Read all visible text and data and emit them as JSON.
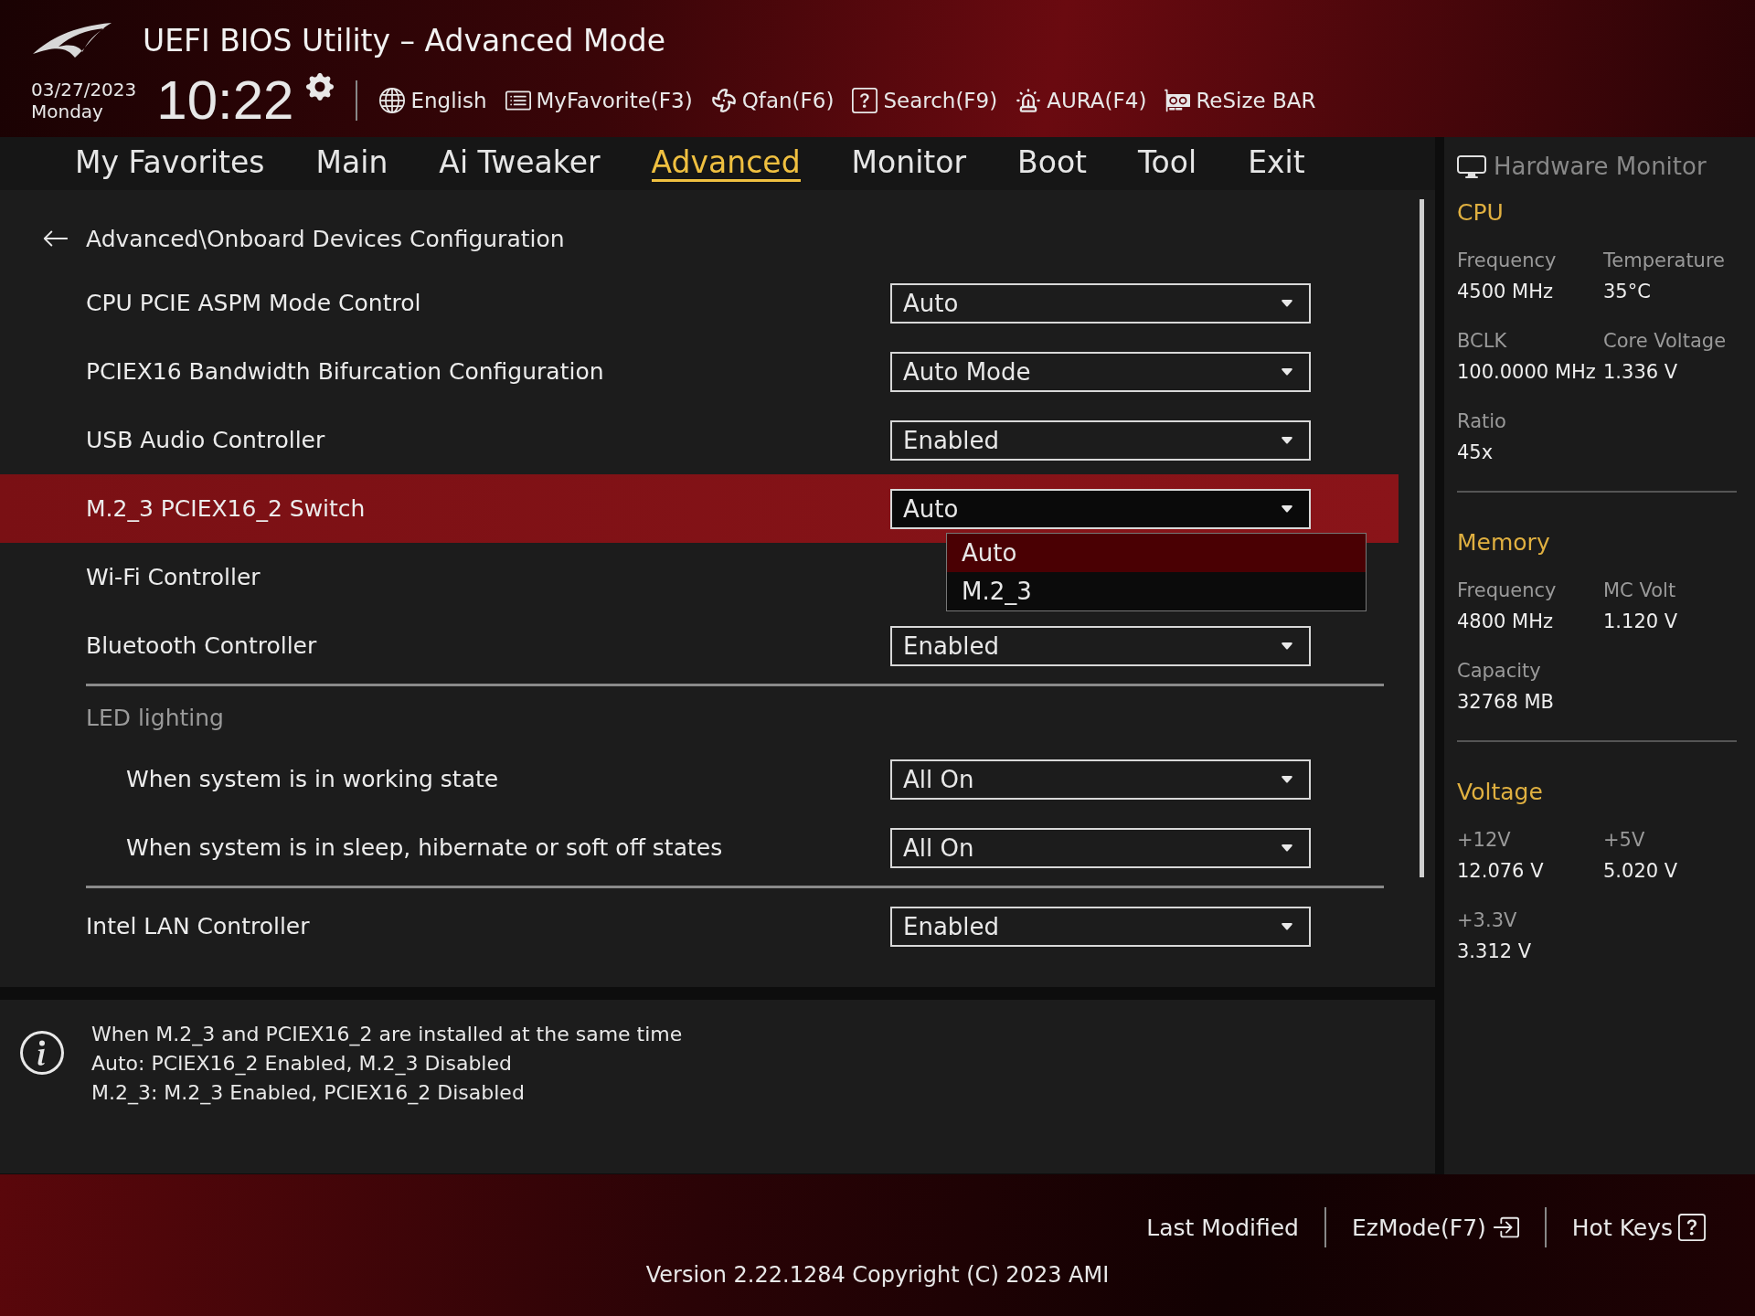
{
  "header": {
    "title": "UEFI BIOS Utility – Advanced Mode",
    "date": "03/27/2023",
    "weekday": "Monday",
    "time": "10:22",
    "tools": [
      {
        "kind": "language",
        "label": "English"
      },
      {
        "kind": "favorite",
        "label": "MyFavorite(F3)"
      },
      {
        "kind": "fan",
        "label": "Qfan(F6)"
      },
      {
        "kind": "search",
        "label": "Search(F9)"
      },
      {
        "kind": "aura",
        "label": "AURA(F4)"
      },
      {
        "kind": "resize",
        "label": "ReSize BAR"
      }
    ]
  },
  "tabs": [
    {
      "label": "My Favorites",
      "selected": false
    },
    {
      "label": "Main",
      "selected": false
    },
    {
      "label": "Ai Tweaker",
      "selected": false
    },
    {
      "label": "Advanced",
      "selected": true
    },
    {
      "label": "Monitor",
      "selected": false
    },
    {
      "label": "Boot",
      "selected": false
    },
    {
      "label": "Tool",
      "selected": false
    },
    {
      "label": "Exit",
      "selected": false
    }
  ],
  "breadcrumb": "Advanced\\Onboard Devices Configuration",
  "sections": [
    {
      "settings": [
        {
          "label": "CPU PCIE ASPM Mode Control",
          "value": "Auto",
          "selected": false
        },
        {
          "label": "PCIEX16 Bandwidth Bifurcation Configuration",
          "value": "Auto Mode",
          "selected": false
        },
        {
          "label": "USB Audio Controller",
          "value": "Enabled",
          "selected": false
        },
        {
          "label": "M.2_3 PCIEX16_2 Switch",
          "value": "Auto",
          "selected": true,
          "options": [
            {
              "label": "Auto",
              "selected": true
            },
            {
              "label": "M.2_3",
              "selected": false
            }
          ]
        },
        {
          "label": "Wi-Fi Controller",
          "selected": false
        },
        {
          "label": "Bluetooth Controller",
          "value": "Enabled",
          "selected": false
        }
      ]
    },
    {
      "heading": "LED lighting",
      "settings": [
        {
          "label": "When system is in working state",
          "value": "All On",
          "selected": false
        },
        {
          "label": "When system is in sleep, hibernate or soft off states",
          "value": "All On",
          "selected": false
        }
      ]
    },
    {
      "settings": [
        {
          "label": "Intel LAN Controller",
          "value": "Enabled",
          "selected": false
        }
      ]
    }
  ],
  "info": [
    "When M.2_3 and PCIEX16_2 are installed at the same time",
    "Auto: PCIEX16_2 Enabled, M.2_3 Disabled",
    "M.2_3: M.2_3 Enabled, PCIEX16_2 Disabled"
  ],
  "hardware_monitor": {
    "title": "Hardware Monitor",
    "groups": [
      {
        "title": "CPU",
        "readings": [
          {
            "label": "Frequency",
            "value": "4500 MHz"
          },
          {
            "label": "Temperature",
            "value": "35°C"
          },
          {
            "label": "BCLK",
            "value": "100.0000 MHz"
          },
          {
            "label": "Core Voltage",
            "value": "1.336 V"
          },
          {
            "label": "Ratio",
            "value": "45x"
          }
        ]
      },
      {
        "title": "Memory",
        "readings": [
          {
            "label": "Frequency",
            "value": "4800 MHz"
          },
          {
            "label": "MC Volt",
            "value": "1.120 V"
          },
          {
            "label": "Capacity",
            "value": "32768 MB"
          }
        ]
      },
      {
        "title": "Voltage",
        "readings": [
          {
            "label": "+12V",
            "value": "12.076 V"
          },
          {
            "label": "+5V",
            "value": "5.020 V"
          },
          {
            "label": "+3.3V",
            "value": "3.312 V"
          }
        ]
      }
    ]
  },
  "footer": {
    "buttons": [
      {
        "kind": "plain",
        "label": "Last Modified"
      },
      {
        "kind": "ezmode",
        "label": "EzMode(F7)"
      },
      {
        "kind": "hotkeys",
        "label": "Hot Keys"
      }
    ],
    "version": "Version 2.22.1284 Copyright (C) 2023 AMI"
  }
}
